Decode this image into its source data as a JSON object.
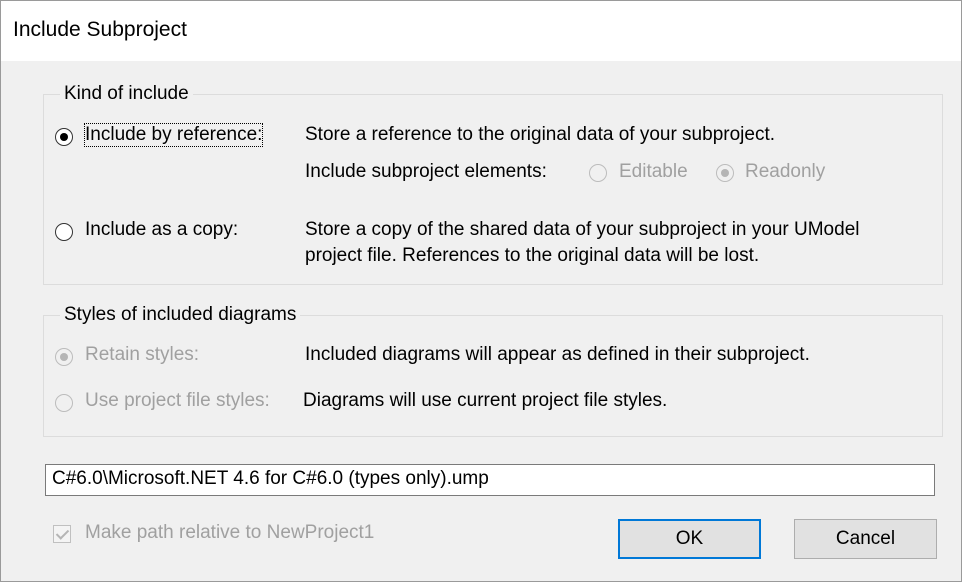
{
  "dialog": {
    "title": "Include Subproject"
  },
  "kind_group": {
    "legend": "Kind of include",
    "by_reference_label": "Include by reference:",
    "by_reference_desc": "Store a reference to the original data of your subproject.",
    "elements_label": "Include subproject elements:",
    "editable_label": "Editable",
    "readonly_label": "Readonly",
    "as_copy_label": "Include as a copy:",
    "as_copy_desc_line1": "Store a copy of the shared data of your subproject in your UModel",
    "as_copy_desc_line2": "project file. References to the original data will be lost."
  },
  "styles_group": {
    "legend": "Styles of included diagrams",
    "retain_label": "Retain styles:",
    "retain_desc": "Included diagrams will appear as defined in their subproject.",
    "use_project_label": "Use project file styles:",
    "use_project_desc": "Diagrams will use current project file styles."
  },
  "path": {
    "value": "C#6.0\\Microsoft.NET 4.6 for C#6.0 (types only).ump"
  },
  "relative_checkbox": {
    "label": "Make path relative to NewProject1",
    "checked": true
  },
  "buttons": {
    "ok": "OK",
    "cancel": "Cancel"
  }
}
